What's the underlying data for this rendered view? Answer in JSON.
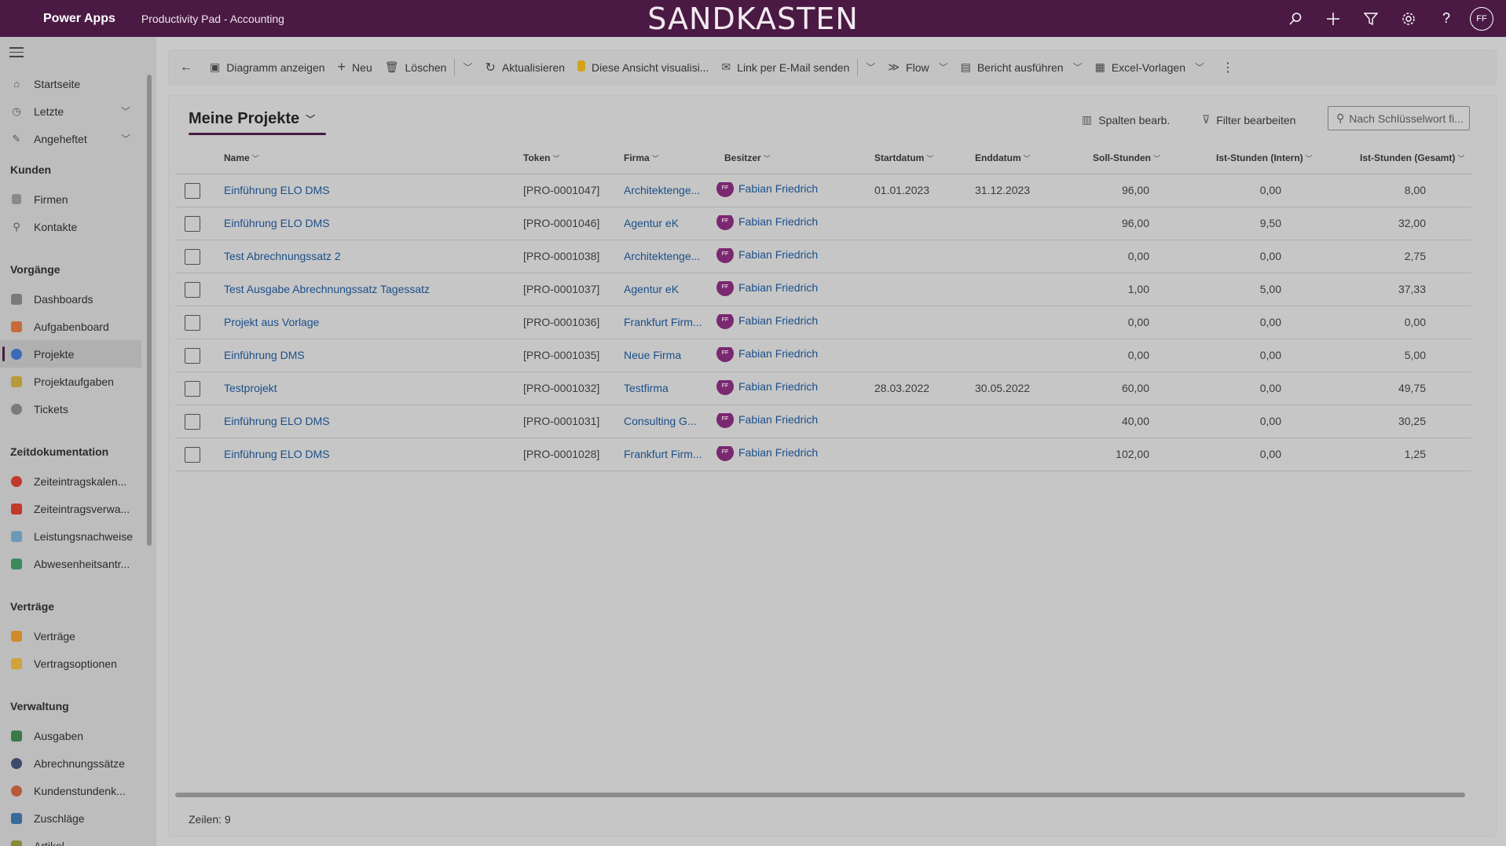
{
  "topbar": {
    "brand": "Power Apps",
    "app_name": "Productivity Pad - Accounting",
    "environment_banner": "SANDKASTEN",
    "avatar_initials": "FF"
  },
  "sidebar": {
    "items_top": [
      {
        "label": "Startseite",
        "icon": "home-icon"
      },
      {
        "label": "Letzte",
        "icon": "clock-icon",
        "expandable": true
      },
      {
        "label": "Angeheftet",
        "icon": "pin-icon",
        "expandable": true
      }
    ],
    "sections": [
      {
        "title": "Kunden",
        "items": [
          {
            "label": "Firmen",
            "icon": "building-icon",
            "color": "#6a6a6a"
          },
          {
            "label": "Kontakte",
            "icon": "person-icon",
            "color": "#6a6a6a"
          }
        ]
      },
      {
        "title": "Vorgänge",
        "items": [
          {
            "label": "Dashboards",
            "icon": "dashboard-icon",
            "color": "#6a6a6a"
          },
          {
            "label": "Aufgabenboard",
            "icon": "taskboard-icon",
            "color": "#c86a3a"
          },
          {
            "label": "Projekte",
            "icon": "project-icon",
            "color": "#3a6ab8",
            "active": true
          },
          {
            "label": "Projektaufgaben",
            "icon": "clipboard-icon",
            "color": "#b89a3a"
          },
          {
            "label": "Tickets",
            "icon": "headset-icon",
            "color": "#6a6a6a"
          }
        ]
      },
      {
        "title": "Zeitdokumentation",
        "items": [
          {
            "label": "Zeiteintragskalen...",
            "icon": "calendar-icon",
            "color": "#c0392b"
          },
          {
            "label": "Zeiteintragsverwa...",
            "icon": "tools-icon",
            "color": "#c0392b"
          },
          {
            "label": "Leistungsnachweise",
            "icon": "document-icon",
            "color": "#6a9ab8"
          },
          {
            "label": "Abwesenheitsantr...",
            "icon": "palm-icon",
            "color": "#3a8a5a"
          }
        ]
      },
      {
        "title": "Verträge",
        "items": [
          {
            "label": "Verträge",
            "icon": "contract-icon",
            "color": "#d08a2a"
          },
          {
            "label": "Vertragsoptionen",
            "icon": "tag-icon",
            "color": "#d0a23a"
          }
        ]
      },
      {
        "title": "Verwaltung",
        "items": [
          {
            "label": "Ausgaben",
            "icon": "expense-icon",
            "color": "#3a7a4a"
          },
          {
            "label": "Abrechnungssätze",
            "icon": "coin-icon",
            "color": "#3a4a6a"
          },
          {
            "label": "Kundenstundenk...",
            "icon": "account-icon",
            "color": "#b85a3a"
          },
          {
            "label": "Zuschläge",
            "icon": "surcharge-icon",
            "color": "#3a6a9a"
          },
          {
            "label": "Artikel",
            "icon": "article-icon",
            "color": "#8a8a3a"
          }
        ]
      }
    ]
  },
  "commandbar": {
    "items": [
      {
        "label": "Diagramm anzeigen",
        "icon": "chart-icon"
      },
      {
        "label": "Neu",
        "icon": "plus-icon"
      },
      {
        "label": "Löschen",
        "icon": "trash-icon"
      },
      {
        "label": "Aktualisieren",
        "icon": "refresh-icon"
      },
      {
        "label": "Diese Ansicht visualisi...",
        "icon": "powerbi-icon"
      },
      {
        "label": "Link per E-Mail senden",
        "icon": "email-link-icon"
      },
      {
        "label": "Flow",
        "icon": "flow-icon"
      },
      {
        "label": "Bericht ausführen",
        "icon": "report-icon"
      },
      {
        "label": "Excel-Vorlagen",
        "icon": "excel-icon"
      }
    ]
  },
  "view": {
    "title": "Meine Projekte",
    "edit_columns": "Spalten bearb.",
    "edit_filters": "Filter bearbeiten",
    "search_placeholder": "Nach Schlüsselwort fi...",
    "row_count": "Zeilen: 9"
  },
  "grid": {
    "columns": [
      "Name",
      "Token",
      "Firma",
      "Besitzer",
      "Startdatum",
      "Enddatum",
      "Soll-Stunden",
      "Ist-Stunden (Intern)",
      "Ist-Stunden (Gesamt)"
    ],
    "rows": [
      {
        "name": "Einführung ELO DMS",
        "token": "[PRO-0001047]",
        "firma": "Architektenge...",
        "owner_initials": "FF",
        "owner": "Fabian Friedrich",
        "start": "01.01.2023",
        "end": "31.12.2023",
        "soll": "96,00",
        "ist_intern": "0,00",
        "ist_gesamt": "8,00"
      },
      {
        "name": "Einführung ELO DMS",
        "token": "[PRO-0001046]",
        "firma": "Agentur eK",
        "owner_initials": "FF",
        "owner": "Fabian Friedrich",
        "start": "",
        "end": "",
        "soll": "96,00",
        "ist_intern": "9,50",
        "ist_gesamt": "32,00"
      },
      {
        "name": "Test Abrechnungssatz 2",
        "token": "[PRO-0001038]",
        "firma": "Architektenge...",
        "owner_initials": "FF",
        "owner": "Fabian Friedrich",
        "start": "",
        "end": "",
        "soll": "0,00",
        "ist_intern": "0,00",
        "ist_gesamt": "2,75"
      },
      {
        "name": "Test Ausgabe Abrechnungssatz Tagessatz",
        "token": "[PRO-0001037]",
        "firma": "Agentur eK",
        "owner_initials": "FF",
        "owner": "Fabian Friedrich",
        "start": "",
        "end": "",
        "soll": "1,00",
        "ist_intern": "5,00",
        "ist_gesamt": "37,33"
      },
      {
        "name": "Projekt aus Vorlage",
        "token": "[PRO-0001036]",
        "firma": "Frankfurt Firm...",
        "owner_initials": "FF",
        "owner": "Fabian Friedrich",
        "start": "",
        "end": "",
        "soll": "0,00",
        "ist_intern": "0,00",
        "ist_gesamt": "0,00"
      },
      {
        "name": "Einführung DMS",
        "token": "[PRO-0001035]",
        "firma": "Neue Firma",
        "owner_initials": "FF",
        "owner": "Fabian Friedrich",
        "start": "",
        "end": "",
        "soll": "0,00",
        "ist_intern": "0,00",
        "ist_gesamt": "5,00"
      },
      {
        "name": "Testprojekt",
        "token": "[PRO-0001032]",
        "firma": "Testfirma",
        "owner_initials": "FF",
        "owner": "Fabian Friedrich",
        "start": "28.03.2022",
        "end": "30.05.2022",
        "soll": "60,00",
        "ist_intern": "0,00",
        "ist_gesamt": "49,75"
      },
      {
        "name": "Einführung ELO DMS",
        "token": "[PRO-0001031]",
        "firma": "Consulting G...",
        "owner_initials": "FF",
        "owner": "Fabian Friedrich",
        "start": "",
        "end": "",
        "soll": "40,00",
        "ist_intern": "0,00",
        "ist_gesamt": "30,25"
      },
      {
        "name": "Einführung ELO DMS",
        "token": "[PRO-0001028]",
        "firma": "Frankfurt Firm...",
        "owner_initials": "FF",
        "owner": "Fabian Friedrich",
        "start": "",
        "end": "",
        "soll": "102,00",
        "ist_intern": "0,00",
        "ist_gesamt": "1,25"
      }
    ]
  }
}
